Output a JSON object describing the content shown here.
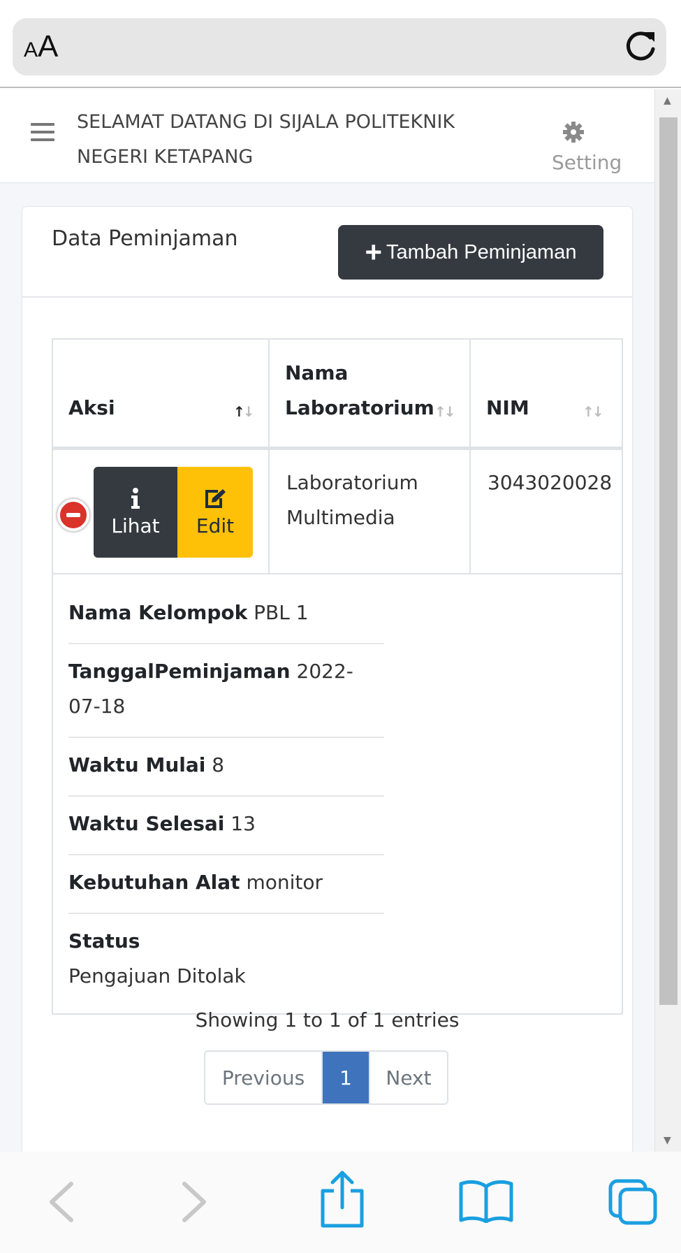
{
  "browser": {
    "aa_small": "A",
    "aa_big": "A"
  },
  "nav": {
    "welcome_line1": "SELAMAT DATANG DI SIJALA POLITEKNIK",
    "welcome_line2": "NEGERI KETAPANG",
    "setting_label": "Setting"
  },
  "card": {
    "title": "Data Peminjaman",
    "add_button_label": "Tambah Peminjaman"
  },
  "table": {
    "headers": {
      "aksi": "Aksi",
      "nama_lab_line1": "Nama",
      "nama_lab_line2": "Laboratorium",
      "nim": "NIM"
    },
    "row": {
      "lihat_label": "Lihat",
      "edit_label": "Edit",
      "lab_line1": "Laboratorium",
      "lab_line2": "Multimedia",
      "nim": "3043020028"
    },
    "details": [
      {
        "label": "Nama Kelompok",
        "value": "PBL 1"
      },
      {
        "label": "TanggalPeminjaman",
        "value": "2022-07-18"
      },
      {
        "label": "Waktu Mulai",
        "value": "8"
      },
      {
        "label": "Waktu Selesai",
        "value": "13"
      },
      {
        "label": "Kebutuhan Alat",
        "value": "monitor"
      },
      {
        "label": "Status",
        "value": "Pengajuan Ditolak"
      }
    ]
  },
  "pagination": {
    "info": "Showing 1 to 1 of 1 entries",
    "previous": "Previous",
    "current": "1",
    "next": "Next"
  },
  "colors": {
    "dark_button": "#343a40",
    "edit_button": "#ffc107",
    "active_page": "#3f74bd",
    "delete_control": "#d9332b",
    "safari_blue": "#1a9fe0"
  },
  "icons": [
    "reload-icon",
    "menu-icon",
    "gear-icon",
    "plus-icon",
    "info-icon",
    "edit-icon",
    "back-icon",
    "forward-icon",
    "share-icon",
    "bookmarks-icon",
    "tabs-icon"
  ]
}
